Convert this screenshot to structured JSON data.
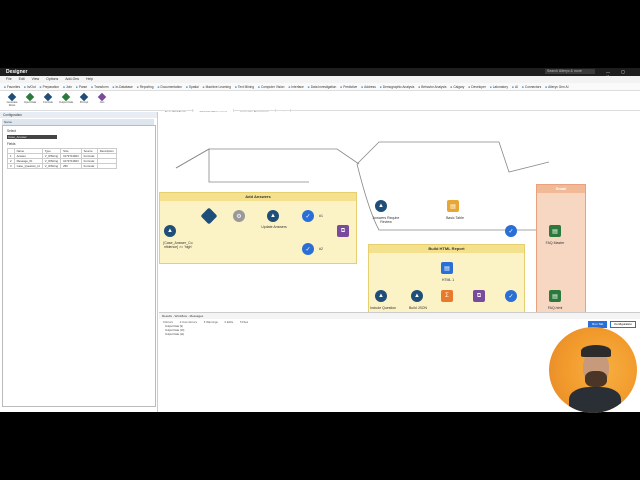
{
  "app": {
    "name": "Designer",
    "search_placeholder": "Search Alteryx & more"
  },
  "menu": [
    "File",
    "Edit",
    "View",
    "Options",
    "Add-Ons",
    "Help"
  ],
  "palette": [
    "Favorites",
    "In/Out",
    "Preparation",
    "Join",
    "Parse",
    "Transform",
    "In-Database",
    "Reporting",
    "Documentation",
    "Spatial",
    "Machine Learning",
    "Text Mining",
    "Computer Vision",
    "Interface",
    "Data Investigation",
    "Predictive",
    "Address",
    "Demographic Analysis",
    "Behavior Analysis",
    "Calgary",
    "Developer",
    "Laboratory",
    "AI",
    "Connectors",
    "Alteryx Gen AI"
  ],
  "tool_icons": [
    "Generate Rows",
    "Input Data",
    "Formula",
    "Output Data",
    "Prompt",
    "Join",
    "Select",
    "Summarize",
    "Sort"
  ],
  "left_panel": {
    "header": "Configuration",
    "tab": "Name",
    "select_label": "Select",
    "selected": "Case_Answer",
    "fields_label": "Fields",
    "columns": [
      "",
      "Name",
      "Type",
      "Size",
      "Source",
      "Description"
    ],
    "rows": [
      [
        "1",
        "Answer",
        "V_WString",
        "1073741823",
        "Formula:",
        ""
      ],
      [
        "2",
        "Message_ID",
        "V_WString",
        "1073741823",
        "Formula:",
        ""
      ],
      [
        "3",
        "Case_Question_Id",
        "V_WString",
        "256",
        "Formula:",
        ""
      ]
    ]
  },
  "doc_tabs": [
    "New Workflow1",
    "FAQ Workflow.yxmd",
    "Generate Responses",
    "+"
  ],
  "canvas": {
    "container_add_answers": "Add Answers",
    "container_build_html": "Build HTML Report",
    "container_small": "Small",
    "label_formula": "[Case_Answer_Co nfidence] >= 'high'",
    "label_update_answers": "Update Answers",
    "label_answers_review": "Answers Require Review",
    "label_basic_table": "Basic Table",
    "label_faq_master": "FAQ Master",
    "label_include_question": "Include Question",
    "label_build_json": "Build JSON",
    "label_html1": "HTML 1",
    "label_html2": "HTML 2",
    "label_faq_html": "FAQ.html",
    "anchor1": "#1",
    "anchor2": "#2"
  },
  "results": {
    "header": "Results - Workflow - Messages",
    "tools": [
      "0 Errors",
      "0 Conv Errors",
      "5 Warnings",
      "0 Edits",
      "5 Files"
    ],
    "lines": [
      "Output Data (9)",
      "Output Data (10)",
      "Output Data (11)"
    ],
    "btn_run": "Run Tab",
    "btn_config": "Configuration"
  },
  "colors": {
    "accent": "#2a6fd6",
    "container": "#fbf2c5",
    "node_blue": "#1f4e79"
  }
}
